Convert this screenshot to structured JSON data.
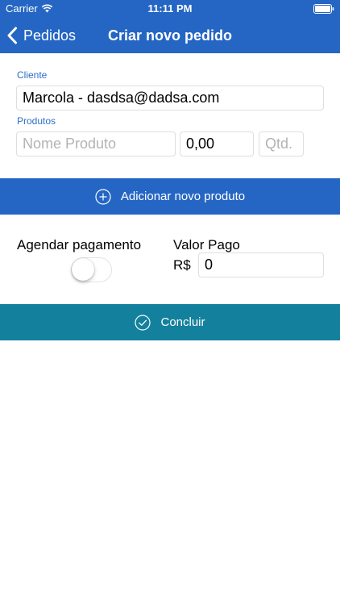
{
  "status_bar": {
    "carrier": "Carrier",
    "time": "11:11 PM"
  },
  "nav": {
    "back_label": "Pedidos",
    "title": "Criar novo pedido"
  },
  "form": {
    "client_label": "Cliente",
    "client_value": "Marcola - dasdsa@dadsa.com",
    "products_label": "Produtos",
    "product_name_placeholder": "Nome Produto",
    "product_price_value": "0,00",
    "product_qty_placeholder": "Qtd.",
    "add_product_label": "Adicionar novo produto",
    "schedule_payment_label": "Agendar pagamento",
    "schedule_payment_on": false,
    "paid_label": "Valor Pago",
    "currency_symbol": "R$",
    "paid_value": "0",
    "finish_label": "Concluir"
  },
  "icons": {
    "back": "chevron-left-icon",
    "add": "plus-circle-icon",
    "finish": "check-circle-icon",
    "wifi": "wifi-icon",
    "battery": "battery-icon"
  },
  "colors": {
    "primary": "#2566c4",
    "finish_button": "#13819d",
    "label_blue": "#2d6fc5",
    "placeholder": "#b3b3b3"
  }
}
